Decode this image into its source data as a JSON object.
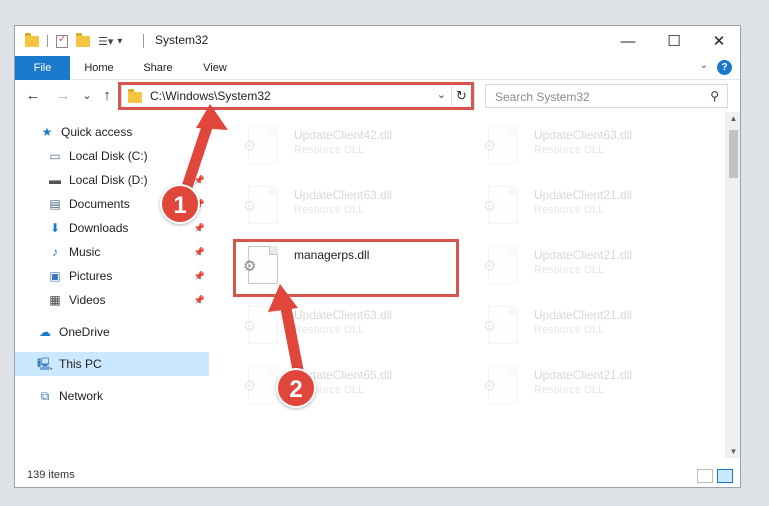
{
  "window": {
    "title": "System32",
    "minimize": "—",
    "maximize": "☐",
    "close": "✕"
  },
  "ribbon": {
    "tabs": [
      {
        "label": "File"
      },
      {
        "label": "Home"
      },
      {
        "label": "Share"
      },
      {
        "label": "View"
      }
    ],
    "help": "?"
  },
  "nav_buttons": {
    "back": "←",
    "forward": "→",
    "recent": "⌄",
    "up": "↑"
  },
  "address": {
    "path": "C:\\Windows\\System32"
  },
  "search": {
    "placeholder": "Search System32"
  },
  "sidebar": {
    "items": [
      {
        "label": "Quick access"
      },
      {
        "label": "Local Disk (C:)"
      },
      {
        "label": "Local Disk (D:)"
      },
      {
        "label": "Documents"
      },
      {
        "label": "Downloads"
      },
      {
        "label": "Music"
      },
      {
        "label": "Pictures"
      },
      {
        "label": "Videos"
      },
      {
        "label": "OneDrive"
      },
      {
        "label": "This PC"
      },
      {
        "label": "Network"
      }
    ]
  },
  "files": [
    {
      "name": "UpdateClient42.dll",
      "type": "Resource DLL"
    },
    {
      "name": "UpdateClient63.dll",
      "type": "Resource DLL"
    },
    {
      "name": "UpdateClient63.dll",
      "type": "Resource DLL"
    },
    {
      "name": "UpdateClient21.dll",
      "type": "Resource DLL"
    },
    {
      "name": "managerps.dll",
      "type": ""
    },
    {
      "name": "UpdateClient21.dll",
      "type": "Resource DLL"
    },
    {
      "name": "UpdateClient63.dll",
      "type": "Resource DLL"
    },
    {
      "name": "UpdateClient21.dll",
      "type": "Resource DLL"
    },
    {
      "name": "UpdateClient65.dll",
      "type": "Resource DLL"
    },
    {
      "name": "UpdateClient21.dll",
      "type": "Resource DLL"
    }
  ],
  "status": {
    "count": "139 items"
  },
  "annotations": {
    "step1": "1",
    "step2": "2",
    "color": "#e0463a"
  }
}
